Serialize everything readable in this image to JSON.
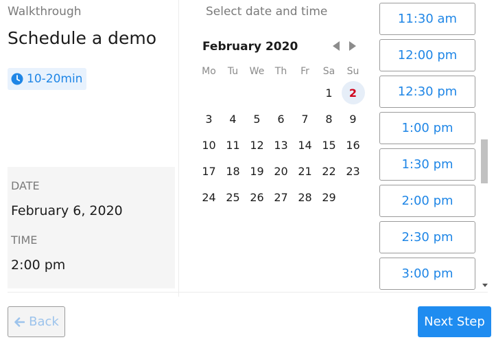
{
  "header": {
    "walkthrough": "Walkthrough",
    "title": "Schedule a demo",
    "duration": "10-20min",
    "duration_icon": "clock-icon"
  },
  "summary": {
    "date_label": "DATE",
    "date_value": "February 6, 2020",
    "time_label": "TIME",
    "time_value": "2:00 pm"
  },
  "calendar": {
    "heading": "Select date and time",
    "month": "February 2020",
    "prev_icon": "triangle-left-icon",
    "next_icon": "triangle-right-icon",
    "weekdays": [
      "Mo",
      "Tu",
      "We",
      "Th",
      "Fr",
      "Sa",
      "Su"
    ],
    "weeks": [
      [
        "",
        "",
        "",
        "",
        "",
        "1",
        "2"
      ],
      [
        "3",
        "4",
        "5",
        "6",
        "7",
        "8",
        "9"
      ],
      [
        "10",
        "11",
        "12",
        "13",
        "14",
        "15",
        "16"
      ],
      [
        "17",
        "18",
        "19",
        "20",
        "21",
        "22",
        "23"
      ],
      [
        "24",
        "25",
        "26",
        "27",
        "28",
        "29",
        ""
      ]
    ],
    "highlighted_day": "2",
    "highlight_color": "#d0021b"
  },
  "time_slots": [
    "11:30 am",
    "12:00 pm",
    "12:30 pm",
    "1:00 pm",
    "1:30 pm",
    "2:00 pm",
    "2:30 pm",
    "3:00 pm"
  ],
  "footer": {
    "back_label": "Back",
    "back_icon": "arrow-left-icon",
    "next_label": "Next Step"
  },
  "colors": {
    "accent": "#1f8cf0",
    "link": "#1f86e6"
  }
}
